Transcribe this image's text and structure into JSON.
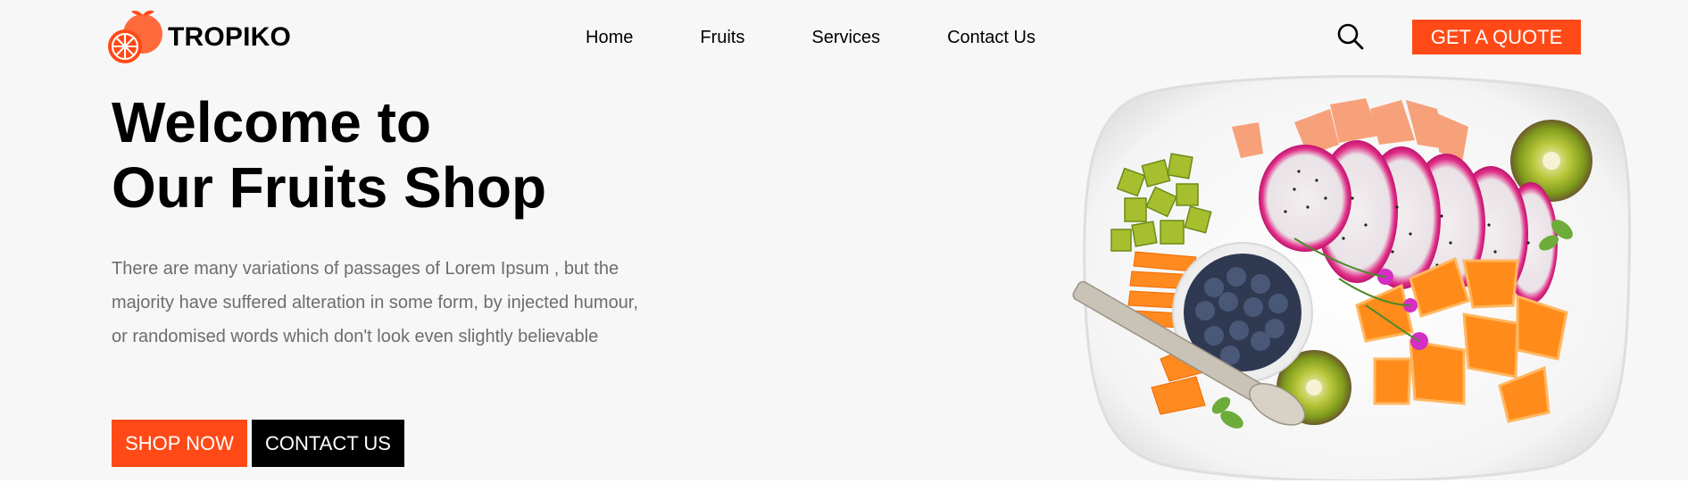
{
  "header": {
    "brand": "TROPIKO",
    "nav": [
      "Home",
      "Fruits",
      "Services",
      "Contact Us"
    ],
    "quote_label": "GET A QUOTE"
  },
  "hero": {
    "title_line1": "Welcome to",
    "title_line2": "Our Fruits Shop",
    "description": "There are many variations of passages of Lorem Ipsum , but the majority have suffered alteration in some form, by injected humour, or randomised words which don't look even slightly believable",
    "shop_label": "SHOP NOW",
    "contact_label": "CONTACT US"
  },
  "icons": {
    "logo": "orange-logo-icon",
    "search": "search-icon"
  },
  "colors": {
    "accent": "#ff4a17",
    "background": "#f7f7f7",
    "text_muted": "#6d6d6d"
  }
}
